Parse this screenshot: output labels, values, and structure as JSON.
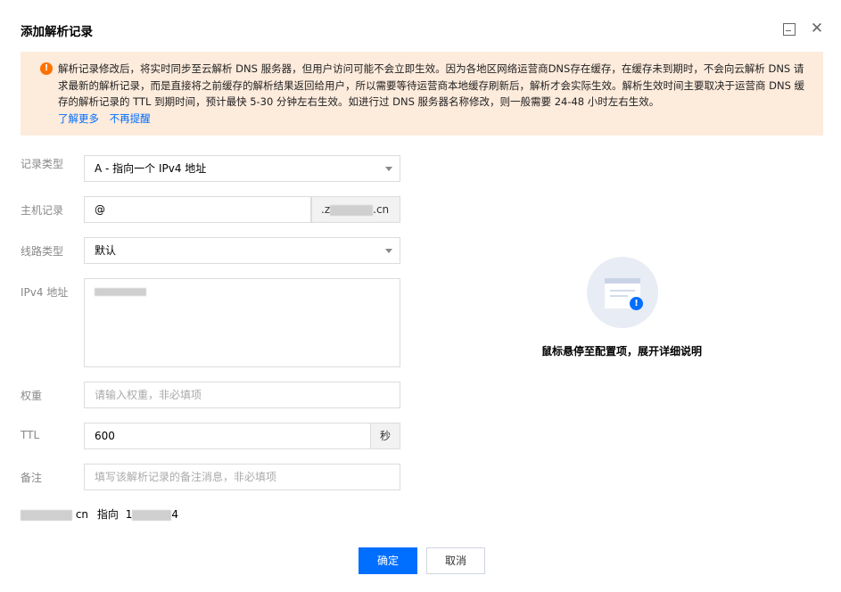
{
  "dialog": {
    "title": "添加解析记录",
    "minimize_icon": "minimize-icon",
    "close_icon": "close-icon",
    "close_glyph": "✕"
  },
  "notice": {
    "icon": "warning-icon",
    "icon_glyph": "!",
    "text": "解析记录修改后，将实时同步至云解析 DNS 服务器，但用户访问可能不会立即生效。因为各地区网络运营商DNS存在缓存，在缓存未到期时，不会向云解析 DNS 请求最新的解析记录，而是直接将之前缓存的解析结果返回给用户，所以需要等待运营商本地缓存刷新后，解析才会实际生效。解析生效时间主要取决于运营商 DNS 缓存的解析记录的 TTL 到期时间，预计最快 5-30 分钟左右生效。如进行过 DNS 服务器名称修改，则一般需要 24-48 小时左右生效。",
    "link_learn_more": "了解更多",
    "link_dismiss": "不再提醒"
  },
  "form": {
    "record_type": {
      "label": "记录类型",
      "value": "A - 指向一个 IPv4 地址"
    },
    "host_record": {
      "label": "主机记录",
      "value": "@",
      "domain_prefix": ".z",
      "domain_suffix": ".cn"
    },
    "line_type": {
      "label": "线路类型",
      "value": "默认"
    },
    "ipv4": {
      "label": "IPv4 地址"
    },
    "weight": {
      "label": "权重",
      "placeholder": "请输入权重，非必填项"
    },
    "ttl": {
      "label": "TTL",
      "value": "600",
      "unit": "秒"
    },
    "remark": {
      "label": "备注",
      "placeholder": "填写该解析记录的备注消息，非必填项"
    }
  },
  "pointing": {
    "domain_suffix": "cn",
    "verb": "指向",
    "ip_prefix": "1",
    "ip_suffix": "4"
  },
  "side_panel": {
    "icon": "document-info-icon",
    "info_glyph": "!",
    "hint": "鼠标悬停至配置项，展开详细说明"
  },
  "buttons": {
    "confirm": "确定",
    "cancel": "取消"
  },
  "colors": {
    "primary": "#006eff",
    "notice_bg": "#fdebdc",
    "warning": "#ff7200"
  }
}
